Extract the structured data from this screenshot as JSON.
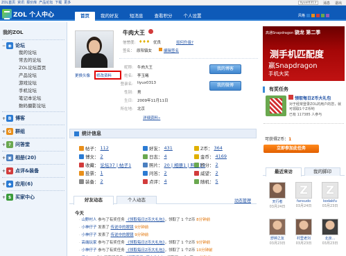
{
  "topbar": {
    "links": [
      "ZOL首页",
      "资讯",
      "报价库",
      "产品论坛",
      "下载",
      "更多"
    ],
    "user": "liyuxi0313",
    "more_links": [
      "消息",
      "退出"
    ]
  },
  "header": {
    "logo_text": "ZOL 个人中心",
    "nav": [
      "首页",
      "我的好友",
      "短消息",
      "查看积分",
      "个人设置"
    ],
    "style_label": "风格",
    "colors": {
      "brand": "#0e5ab8",
      "accent": "#e25f00",
      "sidebar_bg": "#eef4fb"
    }
  },
  "sidebar": {
    "title": "我的ZOL",
    "sections": [
      {
        "label": "论坛",
        "icon": "forum-icon",
        "color": "#2b7bd3",
        "expanded": true,
        "items": [
          "我的论坛",
          "常去的论坛",
          "ZOL论坛首页",
          "产品论坛",
          "游戏论坛",
          "手机论坛",
          "笔记本论坛",
          "数码摄影论坛"
        ]
      },
      {
        "label": "博客",
        "icon": "blog-icon",
        "color": "#2b7bd3",
        "expanded": false,
        "items": []
      },
      {
        "label": "群组",
        "icon": "group-icon",
        "color": "#e88f1b",
        "expanded": false,
        "items": []
      },
      {
        "label": "问答堂",
        "icon": "qa-icon",
        "color": "#6aa84f",
        "expanded": false,
        "items": []
      },
      {
        "label": "相册(20)",
        "icon": "album-icon",
        "color": "#4a7fc0",
        "expanded": false,
        "items": []
      },
      {
        "label": "点评&装备",
        "icon": "review-icon",
        "color": "#d23b3b",
        "expanded": false,
        "items": []
      },
      {
        "label": "应用(6)",
        "icon": "app-icon",
        "color": "#2b7bd3",
        "expanded": false,
        "items": []
      },
      {
        "label": "买家中心",
        "icon": "shop-icon",
        "color": "#3a9b3a",
        "expanded": false,
        "items": []
      }
    ]
  },
  "profile": {
    "name": "牛肉大王",
    "credit_label": "信誉度:",
    "credit_value": "优良",
    "upgrade_link": "如何升级?",
    "sign_label": "签名：",
    "sign_value": "原阳镇女",
    "edit_sign": "编辑签名",
    "change_avatar": "更换头像",
    "edit_profile": "修改资料",
    "fields": [
      {
        "k": "昵称:",
        "v": "牛肉大王"
      },
      {
        "k": "姓名:",
        "v": "李玉曦"
      },
      {
        "k": "登录名:",
        "v": "liyux0313"
      },
      {
        "k": "性别:",
        "v": "男"
      },
      {
        "k": "生日:",
        "v": "2009年11月11日"
      },
      {
        "k": "所在地:",
        "v": "北京"
      }
    ],
    "more_link": "详细资料»",
    "btn_blog": "我的博客",
    "btn_weibo": "我的微博"
  },
  "stats": {
    "title": "统计信息",
    "items": [
      {
        "label": "帖子：",
        "value": "112",
        "color": "#e88f1b"
      },
      {
        "label": "好友：",
        "value": "431",
        "color": "#2b7bd3"
      },
      {
        "label": "Z币：",
        "value": "364",
        "color": "#e0b000"
      },
      {
        "label": "博文：",
        "value": "2",
        "color": "#2b7bd3"
      },
      {
        "label": "日志：",
        "value": "4",
        "color": "#6aa84f"
      },
      {
        "label": "金币：",
        "value": "4169",
        "color": "#e0b000"
      },
      {
        "label": "收藏：",
        "value": "论坛37 | 帖子1",
        "color": "#d23b3b"
      },
      {
        "label": "照片：",
        "value": "20 | 相册1 | 照片19",
        "color": "#4a7fc0"
      },
      {
        "label": "积分：",
        "value": "2",
        "color": "#6aa84f"
      },
      {
        "label": "投票：",
        "value": "1",
        "color": "#e88f1b"
      },
      {
        "label": "问答：",
        "value": "2",
        "color": "#2b7bd3"
      },
      {
        "label": "威望：",
        "value": "2",
        "color": "#d23b3b"
      },
      {
        "label": "装备：",
        "value": "2",
        "color": "#888888"
      },
      {
        "label": "点评：",
        "value": "4",
        "color": "#d23b3b"
      },
      {
        "label": "随机：",
        "value": "5",
        "color": "#6aa84f"
      }
    ]
  },
  "feed": {
    "tabs": [
      "好友动态",
      "个人动态"
    ],
    "settings": "动态管理",
    "today": "今天",
    "rows": [
      {
        "user": "山野村人",
        "text": "参与了有奖任务",
        "task": "《领取每日Z币大礼包》",
        "tail": "，领取了 1 个Z币",
        "time": "8分钟前"
      },
      {
        "user": "小神仔子",
        "text": "发表了",
        "task": "传说中的眼镜",
        "tail": "",
        "time": "9分钟前"
      },
      {
        "user": "小神仔子",
        "text": "发表了",
        "task": "传说中的眼镜",
        "tail": "",
        "time": "9分钟前"
      },
      {
        "user": "高端玩家",
        "text": "参与了有奖任务",
        "task": "《领取每日Z币大礼包》",
        "tail": "，领取了 1 个Z币",
        "time": "9分钟前"
      },
      {
        "user": "小神仔子",
        "text": "参与了有奖任务",
        "task": "《领取每日Z币大礼包》",
        "tail": "，领取了 1 个Z币",
        "time": "10分钟前"
      },
      {
        "user": "爱上Zol",
        "text": "参与了有奖任务",
        "task": "《领取每日Z币大礼包》",
        "tail": "，领取了 1 个Z币",
        "time": "10分钟前"
      }
    ]
  },
  "ad": {
    "line1_brand": "高通Snapdragon",
    "line1_tail": "骁龙 第二季",
    "big": "测手机匹配度",
    "line2": "赢Snapdragon",
    "line3": "手机大奖"
  },
  "tasks": {
    "title": "有奖任务",
    "task_link": "领取每日Z币大礼包",
    "desc": "对于经常登录ZOL的用户的您，就可领取1个Z币哟",
    "joined": "已有 117385 人参与",
    "coins_label": "可获得Z币：",
    "coins_value": "1",
    "cta": "立即参加此任务"
  },
  "visitors": {
    "tabs": [
      "最近来访",
      "我的脚印"
    ],
    "people": [
      {
        "name": "天行者",
        "date": "03月24日",
        "type": "photo"
      },
      {
        "name": "fansudo",
        "date": "03月24日",
        "type": "z"
      },
      {
        "name": "kodakfu",
        "date": "03月23日",
        "type": "z"
      },
      {
        "name": "舒婷之友",
        "date": "03月23日",
        "type": "photo"
      },
      {
        "name": "村里老刘",
        "date": "03月23日",
        "type": "photo"
      },
      {
        "name": "北京...",
        "date": "03月23日",
        "type": "photo"
      }
    ]
  }
}
